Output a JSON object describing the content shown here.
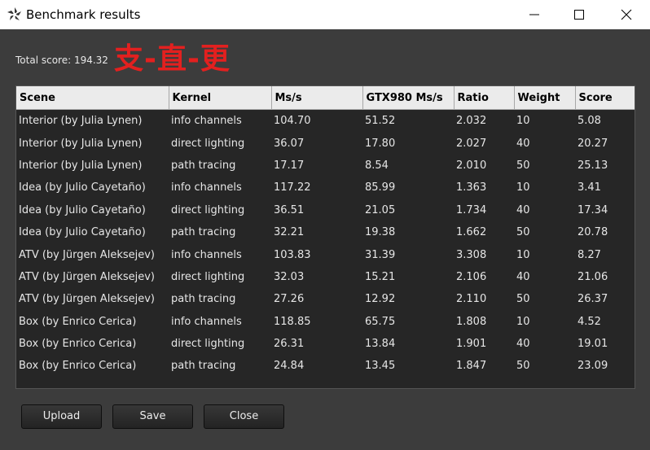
{
  "window": {
    "title": "Benchmark results"
  },
  "total_score": "Total score: 194.32",
  "annotation": "支-直-更",
  "table": {
    "columns": [
      "Scene",
      "Kernel",
      "Ms/s",
      "GTX980 Ms/s",
      "Ratio",
      "Weight",
      "Score"
    ],
    "rows": [
      [
        "Interior (by Julia Lynen)",
        "info channels",
        "104.70",
        "51.52",
        "2.032",
        "10",
        "5.08"
      ],
      [
        "Interior (by Julia Lynen)",
        "direct lighting",
        "36.07",
        "17.80",
        "2.027",
        "40",
        "20.27"
      ],
      [
        "Interior (by Julia Lynen)",
        "path tracing",
        "17.17",
        "8.54",
        "2.010",
        "50",
        "25.13"
      ],
      [
        "Idea (by Julio Cayetaño)",
        "info channels",
        "117.22",
        "85.99",
        "1.363",
        "10",
        "3.41"
      ],
      [
        "Idea (by Julio Cayetaño)",
        "direct lighting",
        "36.51",
        "21.05",
        "1.734",
        "40",
        "17.34"
      ],
      [
        "Idea (by Julio Cayetaño)",
        "path tracing",
        "32.21",
        "19.38",
        "1.662",
        "50",
        "20.78"
      ],
      [
        "ATV (by Jürgen Aleksejev)",
        "info channels",
        "103.83",
        "31.39",
        "3.308",
        "10",
        "8.27"
      ],
      [
        "ATV (by Jürgen Aleksejev)",
        "direct lighting",
        "32.03",
        "15.21",
        "2.106",
        "40",
        "21.06"
      ],
      [
        "ATV (by Jürgen Aleksejev)",
        "path tracing",
        "27.26",
        "12.92",
        "2.110",
        "50",
        "26.37"
      ],
      [
        "Box (by Enrico Cerica)",
        "info channels",
        "118.85",
        "65.75",
        "1.808",
        "10",
        "4.52"
      ],
      [
        "Box (by Enrico Cerica)",
        "direct lighting",
        "26.31",
        "13.84",
        "1.901",
        "40",
        "19.01"
      ],
      [
        "Box (by Enrico Cerica)",
        "path tracing",
        "24.84",
        "13.45",
        "1.847",
        "50",
        "23.09"
      ]
    ]
  },
  "buttons": {
    "upload": "Upload",
    "save": "Save",
    "close": "Close"
  },
  "icons": {
    "app": "app-logo-icon",
    "minimize": "minimize-icon",
    "maximize": "maximize-icon",
    "close": "close-icon"
  },
  "colors": {
    "background": "#3c3c3c",
    "table_bg": "#262626",
    "header_bg": "#ebebeb",
    "annotation": "#e3201f"
  }
}
